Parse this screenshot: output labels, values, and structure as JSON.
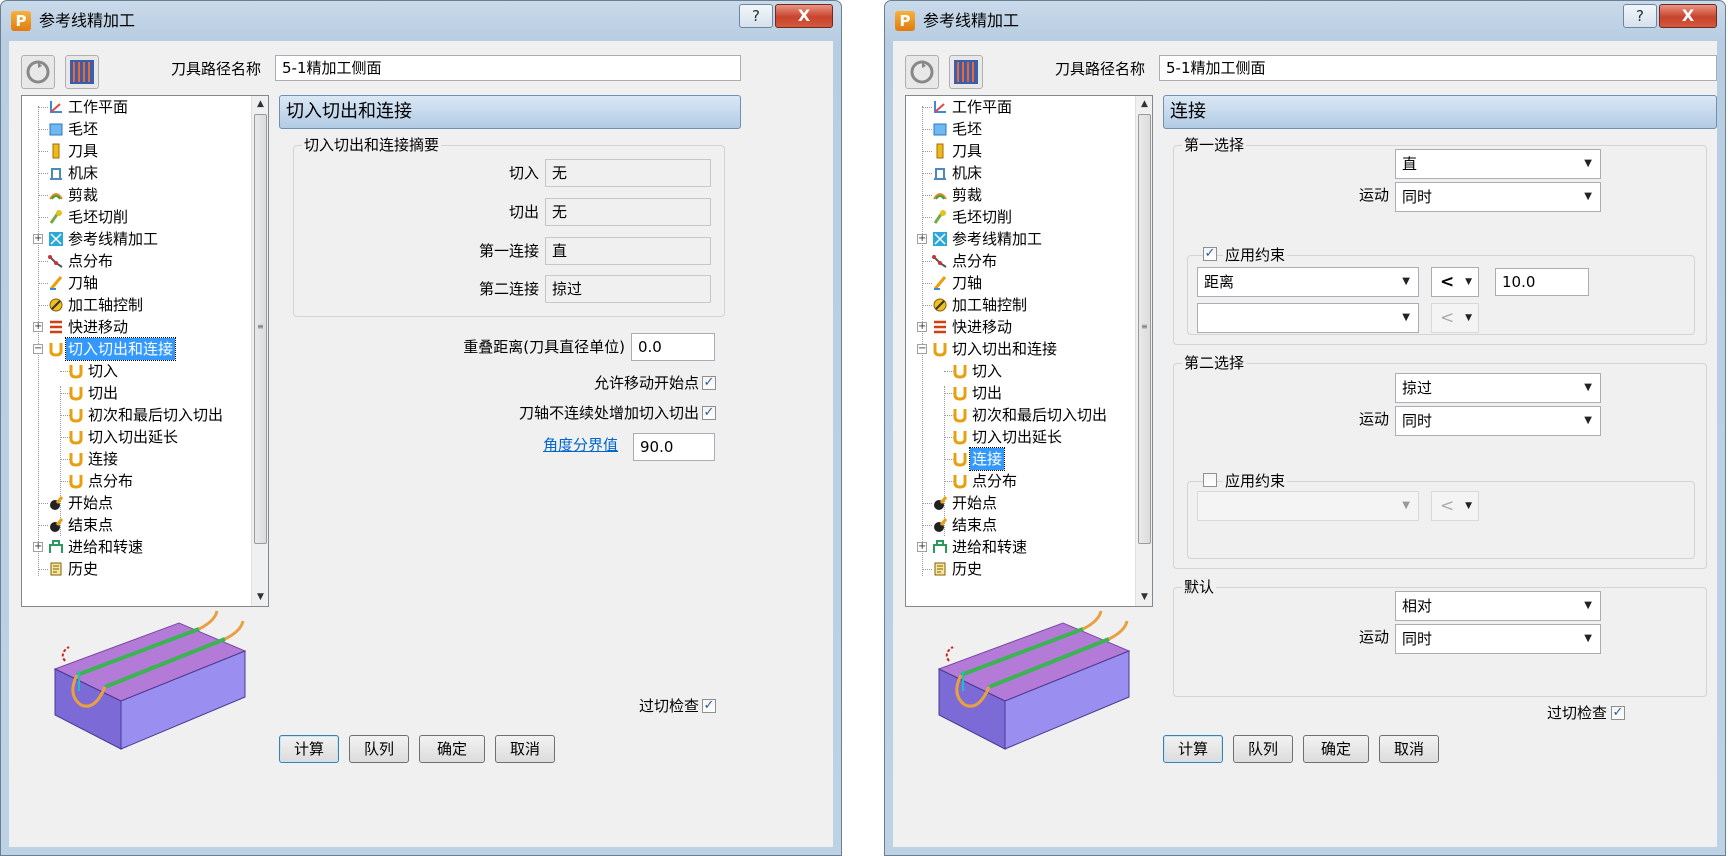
{
  "left_window": {
    "title": "参考线精加工",
    "help_label": "?",
    "close_label": "X",
    "toolpath_name_label": "刀具路径名称",
    "toolpath_name_value": "5-1精加工侧面",
    "tree": [
      {
        "label": "工作平面",
        "icon": "workplane-icon"
      },
      {
        "label": "毛坯",
        "icon": "block-icon"
      },
      {
        "label": "刀具",
        "icon": "tool-icon"
      },
      {
        "label": "机床",
        "icon": "machine-icon"
      },
      {
        "label": "剪裁",
        "icon": "limit-icon"
      },
      {
        "label": "毛坯切削",
        "icon": "stock-cut-icon"
      },
      {
        "label": "参考线精加工",
        "icon": "pattern-finishing-icon"
      },
      {
        "label": "点分布",
        "icon": "point-distribution-icon"
      },
      {
        "label": "刀轴",
        "icon": "tool-axis-icon"
      },
      {
        "label": "加工轴控制",
        "icon": "axis-control-icon"
      },
      {
        "label": "快进移动",
        "icon": "rapid-move-icon"
      },
      {
        "label": "切入切出和连接",
        "icon": "leads-links-icon"
      },
      {
        "label": "切入",
        "icon": "lead-in-icon"
      },
      {
        "label": "切出",
        "icon": "lead-out-icon"
      },
      {
        "label": "初次和最后切入切出",
        "icon": "first-last-leads-icon"
      },
      {
        "label": "切入切出延长",
        "icon": "lead-extension-icon"
      },
      {
        "label": "连接",
        "icon": "links-icon"
      },
      {
        "label": "点分布",
        "icon": "point-distribution-icon"
      },
      {
        "label": "开始点",
        "icon": "start-point-icon"
      },
      {
        "label": "结束点",
        "icon": "end-point-icon"
      },
      {
        "label": "进给和转速",
        "icon": "feeds-speeds-icon"
      },
      {
        "label": "历史",
        "icon": "history-icon"
      }
    ],
    "page_header": "切入切出和连接",
    "summary_title": "切入切出和连接摘要",
    "lead_in_label": "切入",
    "lead_in_value": "无",
    "lead_out_label": "切出",
    "lead_out_value": "无",
    "first_link_label": "第一连接",
    "first_link_value": "直",
    "second_link_label": "第二连接",
    "second_link_value": "掠过",
    "overlap_label": "重叠距离(刀具直径单位)",
    "overlap_value": "0.0",
    "allow_move_start_label": "允许移动开始点",
    "allow_move_start_checked": true,
    "add_leads_label": "刀轴不连续处增加切入切出",
    "add_leads_checked": true,
    "angle_threshold_label": "角度分界值",
    "angle_threshold_value": "90.0",
    "gouge_check_label": "过切检查",
    "gouge_check_checked": true,
    "buttons": {
      "calculate": "计算",
      "queue": "队列",
      "accept": "确定",
      "cancel": "取消"
    }
  },
  "right_window": {
    "title": "参考线精加工",
    "help_label": "?",
    "close_label": "X",
    "toolpath_name_label": "刀具路径名称",
    "toolpath_name_value": "5-1精加工侧面",
    "page_header": "连接",
    "first_choice_title": "第一选择",
    "first_choice_value": "直",
    "first_motion_label": "运动",
    "first_motion_value": "同时",
    "apply_constraint_1_label": "应用约束",
    "apply_constraint_1_checked": true,
    "constraint_type": "距离",
    "constraint_op": "<",
    "constraint_value": "10.0",
    "constraint2_type": "",
    "constraint2_op": "<",
    "second_choice_title": "第二选择",
    "second_choice_value": "掠过",
    "second_motion_label": "运动",
    "second_motion_value": "同时",
    "apply_constraint_2_label": "应用约束",
    "apply_constraint_2_checked": false,
    "constraint3_type": "",
    "constraint3_op": "<",
    "default_title": "默认",
    "default_value": "相对",
    "default_motion_label": "运动",
    "default_motion_value": "同时",
    "gouge_check_label": "过切检查",
    "gouge_check_checked": true,
    "buttons": {
      "calculate": "计算",
      "queue": "队列",
      "accept": "确定",
      "cancel": "取消"
    }
  },
  "colors": {
    "title_bar": "#c9daea",
    "client_bg": "#f0f0f0",
    "selection": "#3399ff",
    "header_bar": "#b2cbe4",
    "link": "#0066cc"
  }
}
